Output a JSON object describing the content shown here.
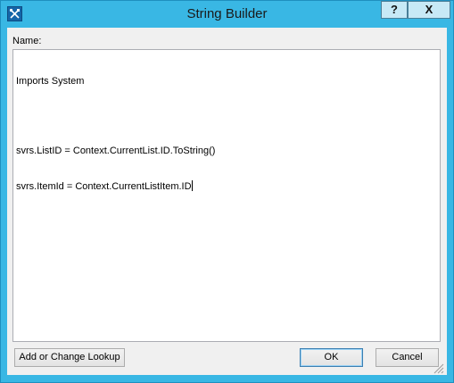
{
  "window": {
    "title": "String Builder",
    "help_label": "?",
    "close_label": "X",
    "icon": "tools-icon"
  },
  "form": {
    "name_label": "Name:",
    "code_lines": [
      "Imports System",
      "",
      "svrs.ListID = Context.CurrentList.ID.ToString()",
      "svrs.ItemId = Context.CurrentListItem.ID"
    ]
  },
  "buttons": {
    "lookup_label": "Add or Change Lookup",
    "ok_label": "OK",
    "cancel_label": "Cancel"
  }
}
